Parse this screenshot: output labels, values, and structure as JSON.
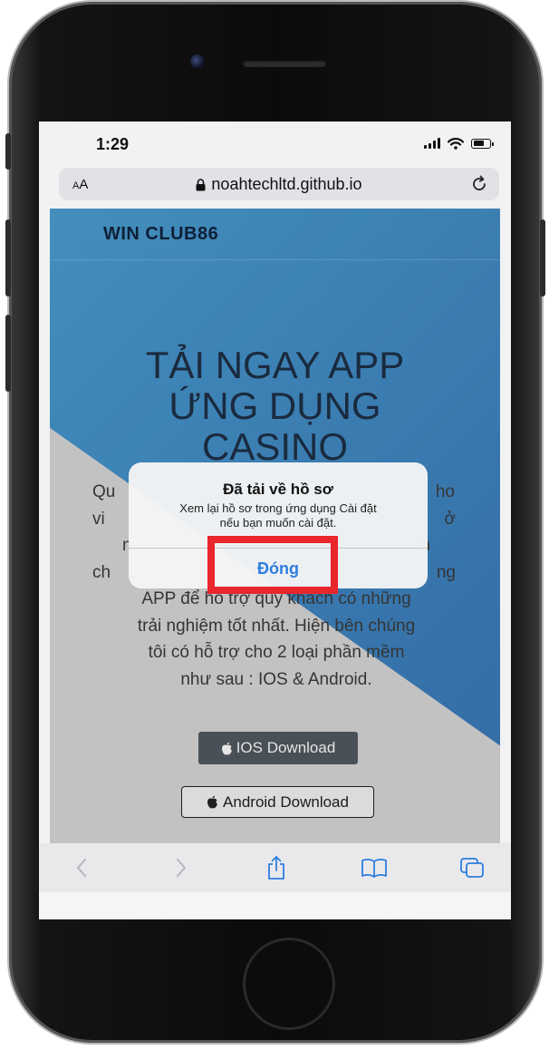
{
  "status_bar": {
    "time": "1:29"
  },
  "address_bar": {
    "text_size_label_small": "A",
    "text_size_label": "A",
    "url": "noahtechltd.github.io"
  },
  "page": {
    "brand": "WIN CLUB86",
    "hero_title_lines": [
      "TẢI NGAY APP",
      "ỨNG DỤNG",
      "CASINO"
    ],
    "body_lines": [
      "Qu",
      "ho",
      "vi",
      "ở",
      "n",
      "n",
      "ch",
      "ng",
      "APP để hỗ trợ quý khách có những",
      "trải nghiệm tốt nhất. Hiện bên chúng",
      "tôi có hỗ trợ cho 2 loại phần mềm",
      "như sau : IOS & Android."
    ],
    "ios_button": "IOS Download",
    "android_button": "Android Download"
  },
  "alert": {
    "title": "Đã tải về hồ sơ",
    "message_line1": "Xem lại hồ sơ trong ứng dụng Cài đặt",
    "message_line2": "nếu bạn muốn cài đặt.",
    "close_button": "Đóng"
  },
  "toolbar": {
    "icons": [
      "back-icon",
      "forward-icon",
      "share-icon",
      "bookmarks-icon",
      "tabs-icon"
    ]
  },
  "colors": {
    "accent": "#2f7de1",
    "highlight": "#e8262b",
    "web_blue": "#4b9fd3"
  }
}
